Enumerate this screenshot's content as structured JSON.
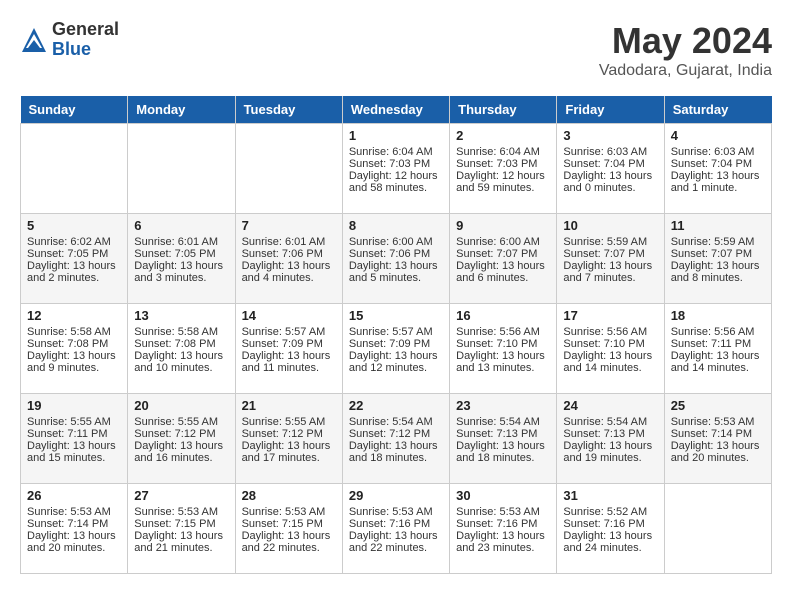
{
  "logo": {
    "general": "General",
    "blue": "Blue"
  },
  "title": "May 2024",
  "location": "Vadodara, Gujarat, India",
  "days_of_week": [
    "Sunday",
    "Monday",
    "Tuesday",
    "Wednesday",
    "Thursday",
    "Friday",
    "Saturday"
  ],
  "weeks": [
    [
      {
        "day": "",
        "sunrise": "",
        "sunset": "",
        "daylight": ""
      },
      {
        "day": "",
        "sunrise": "",
        "sunset": "",
        "daylight": ""
      },
      {
        "day": "",
        "sunrise": "",
        "sunset": "",
        "daylight": ""
      },
      {
        "day": "1",
        "sunrise": "Sunrise: 6:04 AM",
        "sunset": "Sunset: 7:03 PM",
        "daylight": "Daylight: 12 hours and 58 minutes."
      },
      {
        "day": "2",
        "sunrise": "Sunrise: 6:04 AM",
        "sunset": "Sunset: 7:03 PM",
        "daylight": "Daylight: 12 hours and 59 minutes."
      },
      {
        "day": "3",
        "sunrise": "Sunrise: 6:03 AM",
        "sunset": "Sunset: 7:04 PM",
        "daylight": "Daylight: 13 hours and 0 minutes."
      },
      {
        "day": "4",
        "sunrise": "Sunrise: 6:03 AM",
        "sunset": "Sunset: 7:04 PM",
        "daylight": "Daylight: 13 hours and 1 minute."
      }
    ],
    [
      {
        "day": "5",
        "sunrise": "Sunrise: 6:02 AM",
        "sunset": "Sunset: 7:05 PM",
        "daylight": "Daylight: 13 hours and 2 minutes."
      },
      {
        "day": "6",
        "sunrise": "Sunrise: 6:01 AM",
        "sunset": "Sunset: 7:05 PM",
        "daylight": "Daylight: 13 hours and 3 minutes."
      },
      {
        "day": "7",
        "sunrise": "Sunrise: 6:01 AM",
        "sunset": "Sunset: 7:06 PM",
        "daylight": "Daylight: 13 hours and 4 minutes."
      },
      {
        "day": "8",
        "sunrise": "Sunrise: 6:00 AM",
        "sunset": "Sunset: 7:06 PM",
        "daylight": "Daylight: 13 hours and 5 minutes."
      },
      {
        "day": "9",
        "sunrise": "Sunrise: 6:00 AM",
        "sunset": "Sunset: 7:07 PM",
        "daylight": "Daylight: 13 hours and 6 minutes."
      },
      {
        "day": "10",
        "sunrise": "Sunrise: 5:59 AM",
        "sunset": "Sunset: 7:07 PM",
        "daylight": "Daylight: 13 hours and 7 minutes."
      },
      {
        "day": "11",
        "sunrise": "Sunrise: 5:59 AM",
        "sunset": "Sunset: 7:07 PM",
        "daylight": "Daylight: 13 hours and 8 minutes."
      }
    ],
    [
      {
        "day": "12",
        "sunrise": "Sunrise: 5:58 AM",
        "sunset": "Sunset: 7:08 PM",
        "daylight": "Daylight: 13 hours and 9 minutes."
      },
      {
        "day": "13",
        "sunrise": "Sunrise: 5:58 AM",
        "sunset": "Sunset: 7:08 PM",
        "daylight": "Daylight: 13 hours and 10 minutes."
      },
      {
        "day": "14",
        "sunrise": "Sunrise: 5:57 AM",
        "sunset": "Sunset: 7:09 PM",
        "daylight": "Daylight: 13 hours and 11 minutes."
      },
      {
        "day": "15",
        "sunrise": "Sunrise: 5:57 AM",
        "sunset": "Sunset: 7:09 PM",
        "daylight": "Daylight: 13 hours and 12 minutes."
      },
      {
        "day": "16",
        "sunrise": "Sunrise: 5:56 AM",
        "sunset": "Sunset: 7:10 PM",
        "daylight": "Daylight: 13 hours and 13 minutes."
      },
      {
        "day": "17",
        "sunrise": "Sunrise: 5:56 AM",
        "sunset": "Sunset: 7:10 PM",
        "daylight": "Daylight: 13 hours and 14 minutes."
      },
      {
        "day": "18",
        "sunrise": "Sunrise: 5:56 AM",
        "sunset": "Sunset: 7:11 PM",
        "daylight": "Daylight: 13 hours and 14 minutes."
      }
    ],
    [
      {
        "day": "19",
        "sunrise": "Sunrise: 5:55 AM",
        "sunset": "Sunset: 7:11 PM",
        "daylight": "Daylight: 13 hours and 15 minutes."
      },
      {
        "day": "20",
        "sunrise": "Sunrise: 5:55 AM",
        "sunset": "Sunset: 7:12 PM",
        "daylight": "Daylight: 13 hours and 16 minutes."
      },
      {
        "day": "21",
        "sunrise": "Sunrise: 5:55 AM",
        "sunset": "Sunset: 7:12 PM",
        "daylight": "Daylight: 13 hours and 17 minutes."
      },
      {
        "day": "22",
        "sunrise": "Sunrise: 5:54 AM",
        "sunset": "Sunset: 7:12 PM",
        "daylight": "Daylight: 13 hours and 18 minutes."
      },
      {
        "day": "23",
        "sunrise": "Sunrise: 5:54 AM",
        "sunset": "Sunset: 7:13 PM",
        "daylight": "Daylight: 13 hours and 18 minutes."
      },
      {
        "day": "24",
        "sunrise": "Sunrise: 5:54 AM",
        "sunset": "Sunset: 7:13 PM",
        "daylight": "Daylight: 13 hours and 19 minutes."
      },
      {
        "day": "25",
        "sunrise": "Sunrise: 5:53 AM",
        "sunset": "Sunset: 7:14 PM",
        "daylight": "Daylight: 13 hours and 20 minutes."
      }
    ],
    [
      {
        "day": "26",
        "sunrise": "Sunrise: 5:53 AM",
        "sunset": "Sunset: 7:14 PM",
        "daylight": "Daylight: 13 hours and 20 minutes."
      },
      {
        "day": "27",
        "sunrise": "Sunrise: 5:53 AM",
        "sunset": "Sunset: 7:15 PM",
        "daylight": "Daylight: 13 hours and 21 minutes."
      },
      {
        "day": "28",
        "sunrise": "Sunrise: 5:53 AM",
        "sunset": "Sunset: 7:15 PM",
        "daylight": "Daylight: 13 hours and 22 minutes."
      },
      {
        "day": "29",
        "sunrise": "Sunrise: 5:53 AM",
        "sunset": "Sunset: 7:16 PM",
        "daylight": "Daylight: 13 hours and 22 minutes."
      },
      {
        "day": "30",
        "sunrise": "Sunrise: 5:53 AM",
        "sunset": "Sunset: 7:16 PM",
        "daylight": "Daylight: 13 hours and 23 minutes."
      },
      {
        "day": "31",
        "sunrise": "Sunrise: 5:52 AM",
        "sunset": "Sunset: 7:16 PM",
        "daylight": "Daylight: 13 hours and 24 minutes."
      },
      {
        "day": "",
        "sunrise": "",
        "sunset": "",
        "daylight": ""
      }
    ]
  ]
}
